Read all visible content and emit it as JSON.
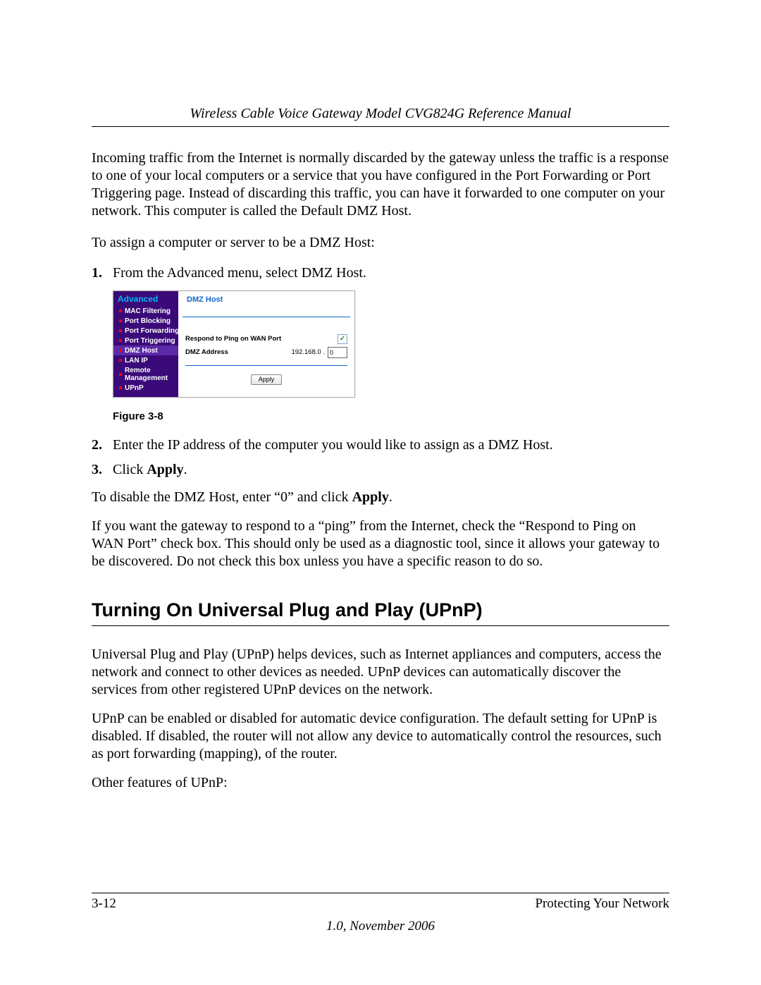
{
  "header": {
    "running_title": "Wireless Cable Voice Gateway Model CVG824G Reference Manual"
  },
  "content": {
    "intro": "Incoming traffic from the Internet is normally discarded by the gateway unless the traffic is a response to one of your local computers or a service that you have configured in the Port Forwarding or Port Triggering page. Instead of discarding this traffic, you can have it forwarded to one computer on your network. This computer is called the Default DMZ Host.",
    "assign_intro": "To assign a computer or server to be a DMZ Host:",
    "steps": {
      "1": {
        "num": "1.",
        "text": "From the Advanced menu, select DMZ Host."
      },
      "2": {
        "num": "2.",
        "text": "Enter the IP address of the computer you would like to assign as a DMZ Host."
      },
      "3": {
        "num": "3.",
        "prefix": "Click ",
        "bold": "Apply",
        "suffix": "."
      }
    },
    "disable_prefix": "To disable the DMZ Host, enter “0” and click ",
    "disable_bold": "Apply",
    "disable_suffix": ".",
    "ping_para": "If you want the gateway to respond to a “ping” from the Internet, check the “Respond to Ping on WAN Port” check box. This should only be used as a diagnostic tool, since it allows your gateway to be discovered. Do not check this box unless you have a specific reason to do so.",
    "h2": "Turning On Universal Plug and Play (UPnP)",
    "upnp_p1": "Universal Plug and Play (UPnP) helps devices, such as Internet appliances and computers, access the network and connect to other devices as needed. UPnP devices can automatically discover the services from other registered UPnP devices on the network.",
    "upnp_p2": "UPnP can be enabled or disabled for automatic device configuration. The default setting for UPnP is disabled. If disabled, the router will not allow any device to automatically control the resources, such as port forwarding (mapping), of the router.",
    "upnp_p3": "Other features of UPnP:"
  },
  "figure": {
    "caption": "Figure 3-8",
    "menu_title": "Advanced",
    "menu_items": [
      "MAC Filtering",
      "Port Blocking",
      "Port Forwarding",
      "Port Triggering",
      "DMZ Host",
      "LAN IP",
      "Remote Management",
      "UPnP"
    ],
    "panel_title": "DMZ Host",
    "row_ping": "Respond to Ping on WAN Port",
    "row_dmz": "DMZ Address",
    "ip_prefix": "192.168.0 .",
    "ip_value": "0",
    "apply": "Apply"
  },
  "footer": {
    "page": "3-12",
    "section": "Protecting Your Network",
    "version": "1.0, November 2006"
  }
}
